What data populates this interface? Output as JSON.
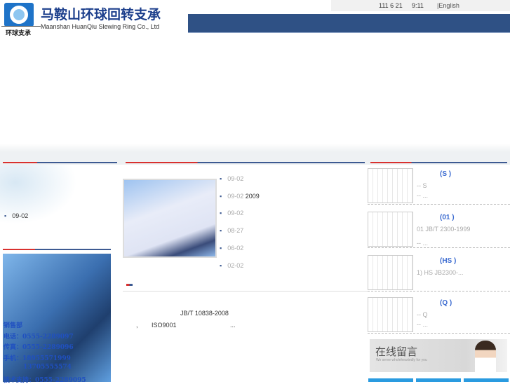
{
  "header": {
    "logo_cn": "马鞍山环球回转支承",
    "logo_en": "Maanshan HuanQiu Slewing Ring Co., Ltd",
    "logo_sub": "环球支承",
    "date": "111 6 21",
    "time": "9:11",
    "language_link": "|English"
  },
  "left": {
    "news_item": "09-02",
    "contact": {
      "dept": "销售部",
      "phone": "电话：0555-2289097",
      "fax": "传真：0555-2289096",
      "mobile": "手机：18955571999",
      "mobile2": "13705555574",
      "support": "技术支持：0555-2289095"
    }
  },
  "middle": {
    "news": [
      {
        "date": "09-02",
        "title": ""
      },
      {
        "date": "09-02",
        "title": "2009"
      },
      {
        "date": "09-02",
        "title": ""
      },
      {
        "date": "08-27",
        "title": ""
      },
      {
        "date": "06-02",
        "title": ""
      },
      {
        "date": "02-02",
        "title": ""
      }
    ],
    "intro_line1": "JB/T 10838-2008",
    "intro_comma": ",",
    "intro_line2": "ISO9001",
    "intro_more": "..."
  },
  "products": [
    {
      "title": "(S   )",
      "line1": "--        S",
      "line2": "-- ..."
    },
    {
      "title": "(01   )",
      "line1": "01  JB/T 2300-1999",
      "line2": "--      ..."
    },
    {
      "title": "(HS   )",
      "line1": "1) HS            JB2300-...",
      "line2": ""
    },
    {
      "title": "(Q   )",
      "line1": "--        Q",
      "line2": "-- ..."
    }
  ],
  "online_message": {
    "title": "在线留言",
    "subtitle": "We serve wholeheartedly for you"
  }
}
